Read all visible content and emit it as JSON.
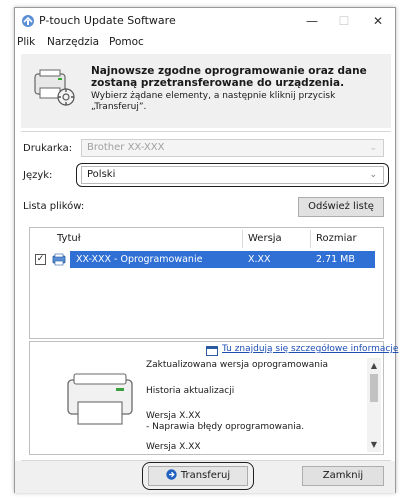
{
  "window": {
    "title": "P-touch Update Software",
    "controls": {
      "minimize": "—",
      "maximize": "☐",
      "close": "✕"
    }
  },
  "menu": [
    "Plik",
    "Narzędzia",
    "Pomoc"
  ],
  "header": {
    "icon": "printer-update-icon",
    "title": "Najnowsze zgodne oprogramowanie oraz dane zostaną przetransferowane do urządzenia.",
    "subtitle": "Wybierz żądane elementy, a następnie kliknij przycisk „Transferuj”."
  },
  "form": {
    "printer_label": "Drukarka:",
    "printer_value": "Brother XX-XXX",
    "language_label": "Język:",
    "language_value": "Polski"
  },
  "file_list": {
    "label": "Lista plików:",
    "refresh_button": "Odśwież listę",
    "columns": [
      "Tytuł",
      "Wersja",
      "Rozmiar"
    ],
    "rows": [
      {
        "checked": true,
        "title": "XX-XXX  - Oprogramowanie",
        "version": "X.XX",
        "size": "2.71 MB"
      }
    ]
  },
  "info": {
    "link_text": "Tu znajdują się szczegółowe informacje",
    "description": [
      "Zaktualizowana wersja oprogramowania",
      "Historia aktualizacji",
      "Wersja X.XX",
      "- Naprawia błędy oprogramowania.",
      "Wersja X.XX"
    ]
  },
  "footer": {
    "transfer_button": "Transferuj",
    "close_button": "Zamknij"
  },
  "colors": {
    "selection": "#3070d4",
    "link": "#1f4fb5",
    "panel": "#f0f0f0"
  }
}
